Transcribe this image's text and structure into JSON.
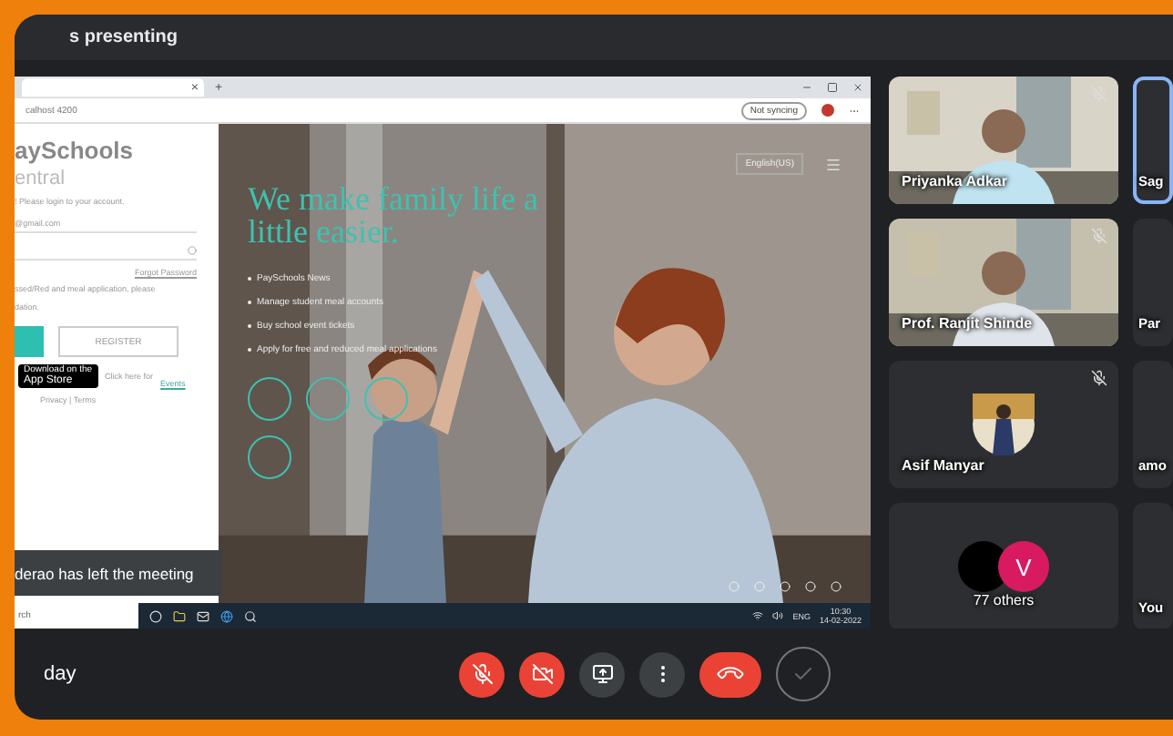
{
  "top_bar": {
    "title": "s presenting"
  },
  "shared_screen": {
    "browser": {
      "tab_close": "×",
      "new_tab": "+",
      "address": "calhost 4200",
      "sync_button": "Not syncing"
    },
    "login": {
      "brand_top": "aySchools",
      "brand_bottom": "entral",
      "prompt": "! Please login to your account.",
      "email_value": "@gmail.com",
      "forgot": "Forgot Password",
      "notice": "ssed/Red and meal application, please",
      "notice_2": "dation.",
      "register": "REGISTER",
      "store_badge": "App Store",
      "store_small": "Download on the",
      "click_here": "Click here for",
      "events": "Events",
      "links": "Privacy | Terms"
    },
    "hero": {
      "language": "English(US)",
      "headline": "We make family life a little easier.",
      "bullets": [
        "PaySchools News",
        "Manage student meal accounts",
        "Buy school event tickets",
        "Apply for free and reduced meal applications"
      ]
    },
    "notification": "derao has left the meeting",
    "taskbar": {
      "search": "rch",
      "lang": "ENG",
      "time": "10:30",
      "date": "14-02-2022"
    }
  },
  "meeting_name": "day",
  "controls": [
    {
      "kind": "mic",
      "off": true
    },
    {
      "kind": "camera",
      "off": true
    },
    {
      "kind": "present",
      "off": false
    },
    {
      "kind": "more",
      "off": false
    },
    {
      "kind": "leave"
    },
    {
      "kind": "check"
    }
  ],
  "tiles": [
    {
      "name": "Priyanka Adkar",
      "kind": "video",
      "muted": true,
      "selected": false
    },
    {
      "name": "Sag",
      "kind": "blank",
      "muted": false,
      "selected": true
    },
    {
      "name": "Prof. Ranjit Shinde",
      "kind": "video",
      "muted": true,
      "selected": false
    },
    {
      "name": "Par",
      "kind": "blank",
      "muted": false,
      "selected": false
    },
    {
      "name": "Asif Manyar",
      "kind": "avatar",
      "muted": true,
      "selected": false
    },
    {
      "name": "amo",
      "kind": "blank",
      "muted": false,
      "selected": false
    },
    {
      "name": "77 others",
      "kind": "others",
      "muted": false,
      "selected": false,
      "avatars": [
        {
          "color": "#000000"
        },
        {
          "letter": "V",
          "color": "#d81b60"
        }
      ]
    },
    {
      "name": "You",
      "kind": "blank",
      "muted": false,
      "selected": false
    }
  ]
}
